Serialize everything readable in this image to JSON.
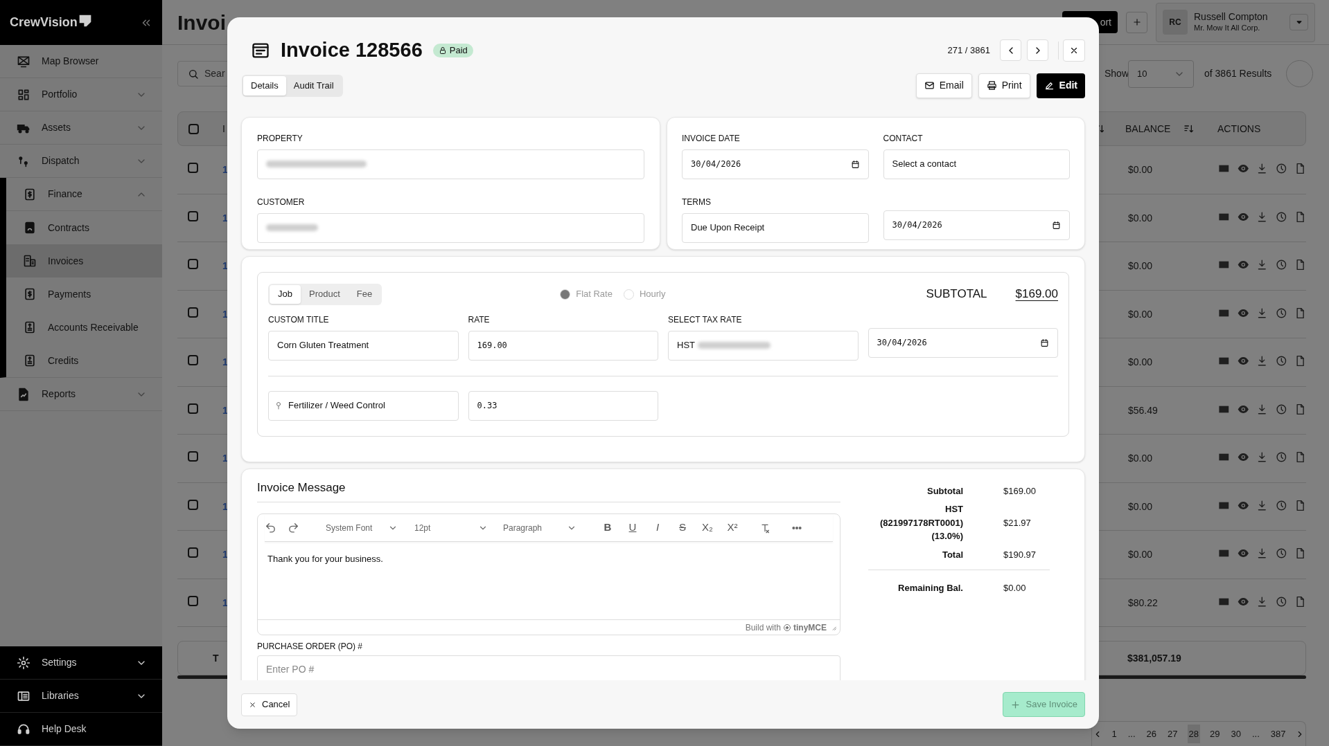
{
  "sidebar": {
    "brand": "CrewVision",
    "items": [
      {
        "label": "Map Browser",
        "kind": "map",
        "selected": false
      },
      {
        "label": "Portfolio",
        "kind": "portfolio",
        "selected": false,
        "expanded": false
      },
      {
        "label": "Assets",
        "kind": "truck",
        "selected": false,
        "expanded": false
      },
      {
        "label": "Dispatch",
        "kind": "dispatch",
        "selected": false,
        "expanded": false
      },
      {
        "label": "Finance",
        "kind": "dollar",
        "selected": false,
        "expanded": true,
        "children": [
          {
            "label": "Contracts",
            "kind": "contract",
            "selected": false
          },
          {
            "label": "Invoices",
            "kind": "invoice",
            "selected": true
          },
          {
            "label": "Payments",
            "kind": "dollar",
            "selected": false
          },
          {
            "label": "Accounts Receivable",
            "kind": "ledger",
            "selected": false
          },
          {
            "label": "Credits",
            "kind": "ledger",
            "selected": false
          }
        ]
      },
      {
        "label": "Reports",
        "kind": "report",
        "selected": false,
        "expanded": false
      }
    ],
    "bottom": [
      {
        "label": "Settings",
        "kind": "gear",
        "expanded": false
      },
      {
        "label": "Libraries",
        "kind": "library",
        "expanded": false
      },
      {
        "label": "Help Desk",
        "kind": "help"
      }
    ]
  },
  "page": {
    "title": "Invoi",
    "search_placeholder": "Sear",
    "export_label": "ort",
    "user": {
      "initials": "RC",
      "name": "Russell Compton",
      "company": "Mr. Mow It All Corp."
    },
    "show_label": "Show",
    "page_size": "10",
    "results": "of 3861 Results"
  },
  "table": {
    "columns": [
      "I",
      "BALANCE",
      "ACTIONS"
    ],
    "all_checked": false,
    "rows": [
      {
        "id": "1",
        "balance": "$0.00",
        "checked": false
      },
      {
        "id": "1",
        "balance": "$0.00",
        "checked": false
      },
      {
        "id": "1",
        "balance": "$0.00",
        "checked": false
      },
      {
        "id": "1",
        "balance": "$0.00",
        "checked": false
      },
      {
        "id": "1",
        "balance": "$0.00",
        "checked": false
      },
      {
        "id": "1",
        "balance": "$56.49",
        "checked": false
      },
      {
        "id": "1",
        "balance": "$0.00",
        "checked": false
      },
      {
        "id": "1",
        "balance": "$0.00",
        "checked": false
      },
      {
        "id": "1",
        "balance": "$0.00",
        "checked": false
      },
      {
        "id": "1",
        "balance": "$80.22",
        "checked": false
      }
    ],
    "total": {
      "label": "T",
      "balance": "$381,057.19"
    }
  },
  "pagination": [
    {
      "label": "1",
      "selected": false
    },
    {
      "label": "...",
      "selected": false
    },
    {
      "label": "26",
      "selected": false
    },
    {
      "label": "27",
      "selected": false
    },
    {
      "label": "28",
      "selected": true
    },
    {
      "label": "29",
      "selected": false
    },
    {
      "label": "30",
      "selected": false
    },
    {
      "label": "...",
      "selected": false
    },
    {
      "label": "387",
      "selected": false
    }
  ],
  "modal": {
    "title": "Invoice 128566",
    "status": "Paid",
    "position": "271 / 3861",
    "tabs": [
      {
        "label": "Details",
        "selected": true
      },
      {
        "label": "Audit Trail",
        "selected": false
      }
    ],
    "actions": [
      {
        "label": "Email",
        "kind": "email"
      },
      {
        "label": "Print",
        "kind": "print"
      },
      {
        "label": "Edit",
        "kind": "edit"
      }
    ],
    "details": {
      "property_label": "PROPERTY",
      "customer_label": "CUSTOMER",
      "invoice_date_label": "INVOICE DATE",
      "invoice_date": "30/04/2026",
      "contact_label": "CONTACT",
      "contact_placeholder": "Select a contact",
      "terms_label": "TERMS",
      "terms": "Due Upon Receipt",
      "due_date": "30/04/2026"
    },
    "line_item": {
      "types": [
        {
          "label": "Job",
          "selected": true
        },
        {
          "label": "Product",
          "selected": false
        },
        {
          "label": "Fee",
          "selected": false
        }
      ],
      "rate_modes": [
        {
          "label": "Flat Rate",
          "selected": true
        },
        {
          "label": "Hourly",
          "selected": false
        }
      ],
      "subtotal_label": "SUBTOTAL",
      "subtotal": "$169.00",
      "custom_title_label": "CUSTOM TITLE",
      "custom_title": "Corn Gluten Treatment",
      "rate_label": "RATE",
      "rate": "169.00",
      "tax_label": "SELECT TAX RATE",
      "tax": "HST",
      "date": "30/04/2026",
      "category": "Fertilizer / Weed Control",
      "quantity": "0.33"
    },
    "message": {
      "heading": "Invoice Message",
      "font": "System Font",
      "size": "12pt",
      "block": "Paragraph",
      "buttons": [
        {
          "label": "B",
          "kind": "bold"
        },
        {
          "label": "U",
          "kind": "underline"
        },
        {
          "label": "I",
          "kind": "italic"
        },
        {
          "label": "S",
          "kind": "strike"
        },
        {
          "label": "X₂",
          "kind": "sub"
        },
        {
          "label": "X²",
          "kind": "sup"
        }
      ],
      "body": "Thank you for your business.",
      "branding": "Build with",
      "brand": "tinyMCE",
      "po_label": "PURCHASE ORDER (PO) #",
      "po_placeholder": "Enter PO #"
    },
    "totals": [
      {
        "label": "Subtotal",
        "value": "$169.00"
      },
      {
        "label": "HST (821997178RT0001) (13.0%)",
        "value": "$21.97"
      },
      {
        "label": "Total",
        "value": "$190.97"
      },
      {
        "label": "Remaining Bal.",
        "value": "$0.00",
        "kind": "balance"
      }
    ],
    "footer": {
      "cancel": "Cancel",
      "save": "Save Invoice",
      "save_disabled": true
    }
  }
}
